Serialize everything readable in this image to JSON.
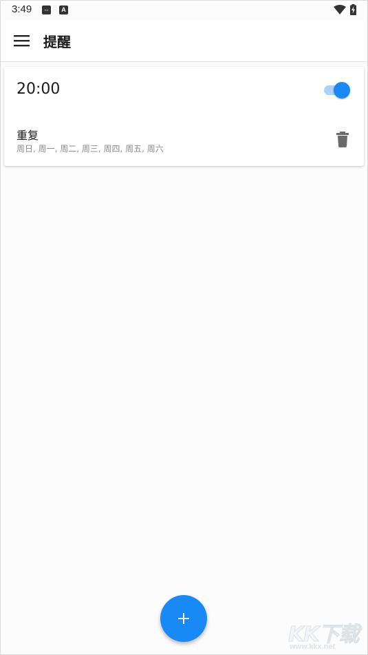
{
  "status_bar": {
    "time": "3:49",
    "notification_icons": [
      "⇔",
      "A"
    ]
  },
  "app_bar": {
    "title": "提醒",
    "menu_icon": "hamburger-menu-icon"
  },
  "reminders": [
    {
      "time": "20:00",
      "enabled": true,
      "repeat_label": "重复",
      "repeat_days": "周日, 周一, 周二, 周三, 周四, 周五, 周六"
    }
  ],
  "fab": {
    "icon": "plus-icon"
  },
  "watermark": {
    "brand": "KK下载",
    "url": "www.kkx.net"
  },
  "colors": {
    "accent": "#1989f5",
    "accent_light": "#a9d2fb",
    "text_primary": "#1a1a1a",
    "text_secondary": "#8a8a8a"
  }
}
